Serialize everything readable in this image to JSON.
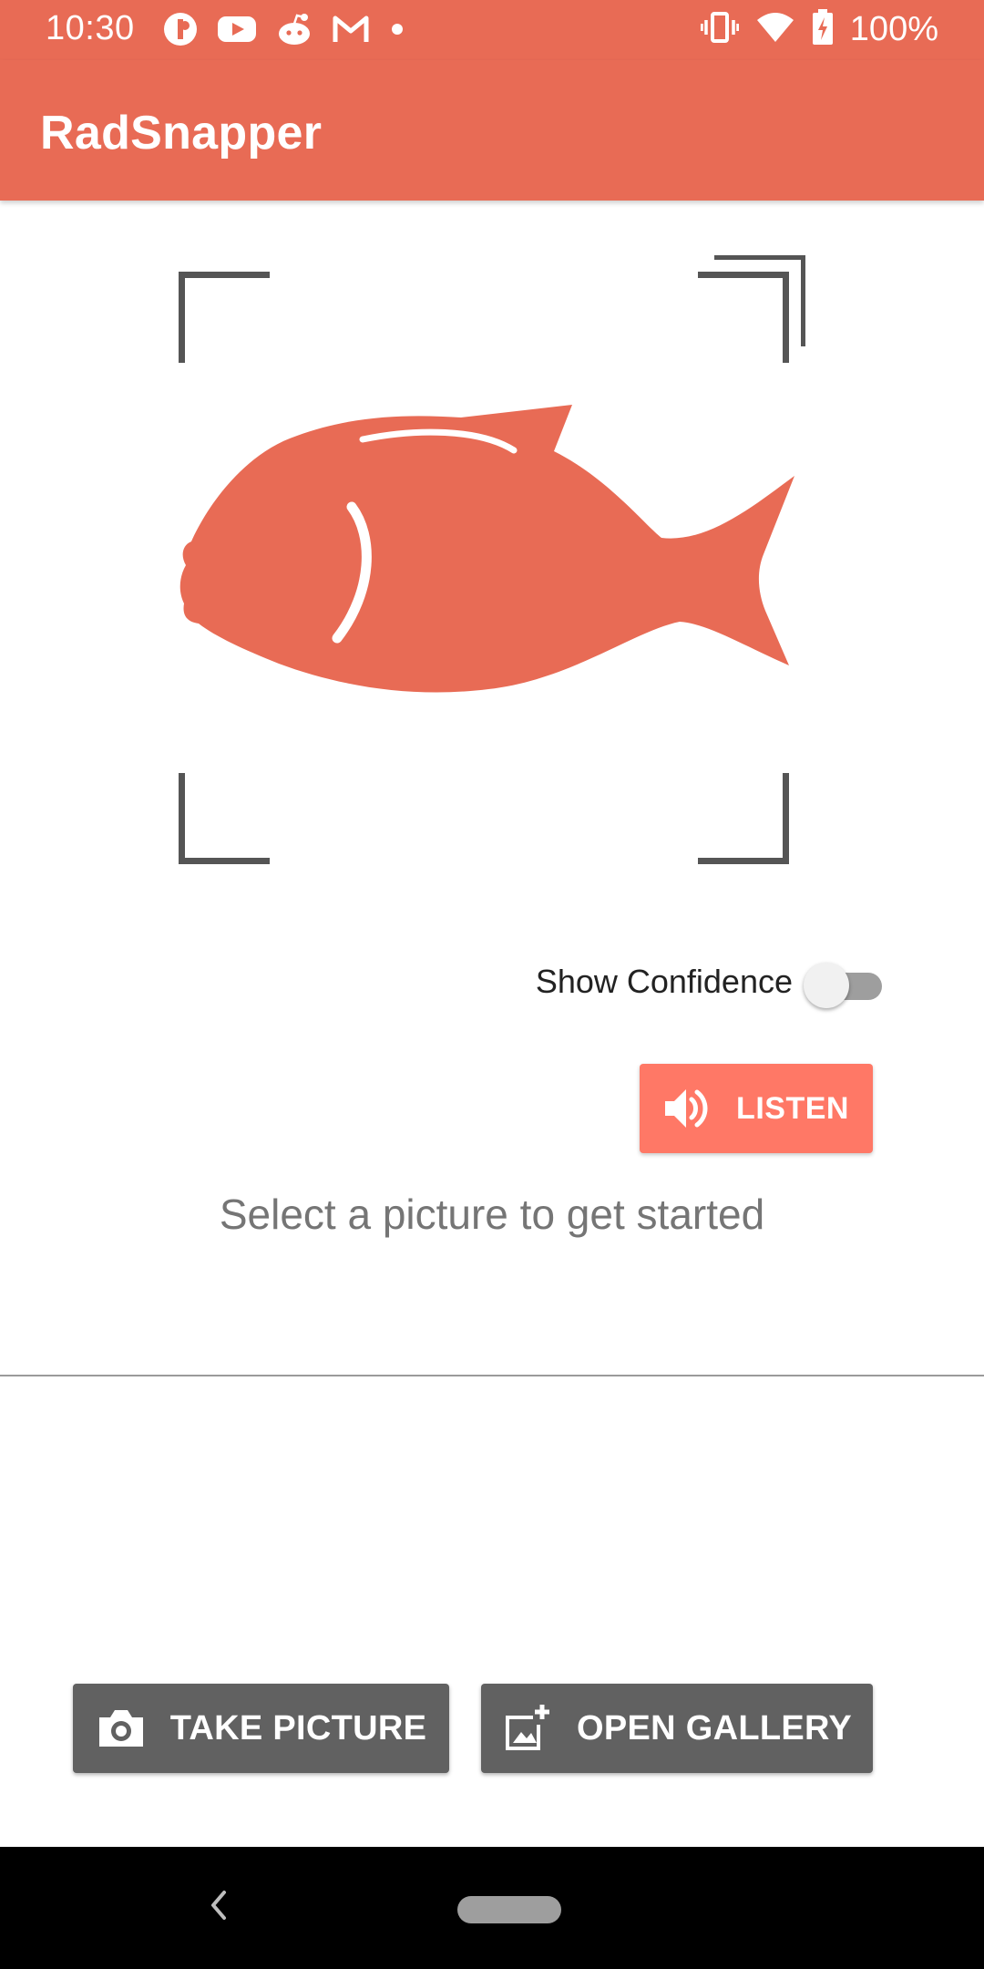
{
  "status_bar": {
    "time": "10:30",
    "notification_icons": [
      "podcast-app-icon",
      "youtube-icon",
      "reddit-icon",
      "gmail-icon",
      "more-notifications-dot-icon"
    ],
    "system_icons": [
      "vibrate-icon",
      "wifi-icon",
      "battery-charging-icon"
    ],
    "battery": "100%"
  },
  "app_bar": {
    "title": "RadSnapper"
  },
  "viewfinder": {
    "placeholder_icon": "fish-icon"
  },
  "confidence": {
    "label": "Show Confidence",
    "enabled": false
  },
  "listen_button": {
    "label": "LISTEN",
    "icon": "speaker-icon"
  },
  "prompt": {
    "text": "Select a picture to get started"
  },
  "actions": {
    "take_picture": {
      "label": "TAKE PICTURE",
      "icon": "camera-icon"
    },
    "open_gallery": {
      "label": "OPEN GALLERY",
      "icon": "add-photo-icon"
    }
  },
  "nav_bar": {
    "icons": [
      "back-icon",
      "home-pill-icon"
    ]
  },
  "colors": {
    "accent": "#E86B55",
    "listen_button": "#FF7866",
    "action_button": "#616161",
    "corner_brackets": "#555555"
  }
}
